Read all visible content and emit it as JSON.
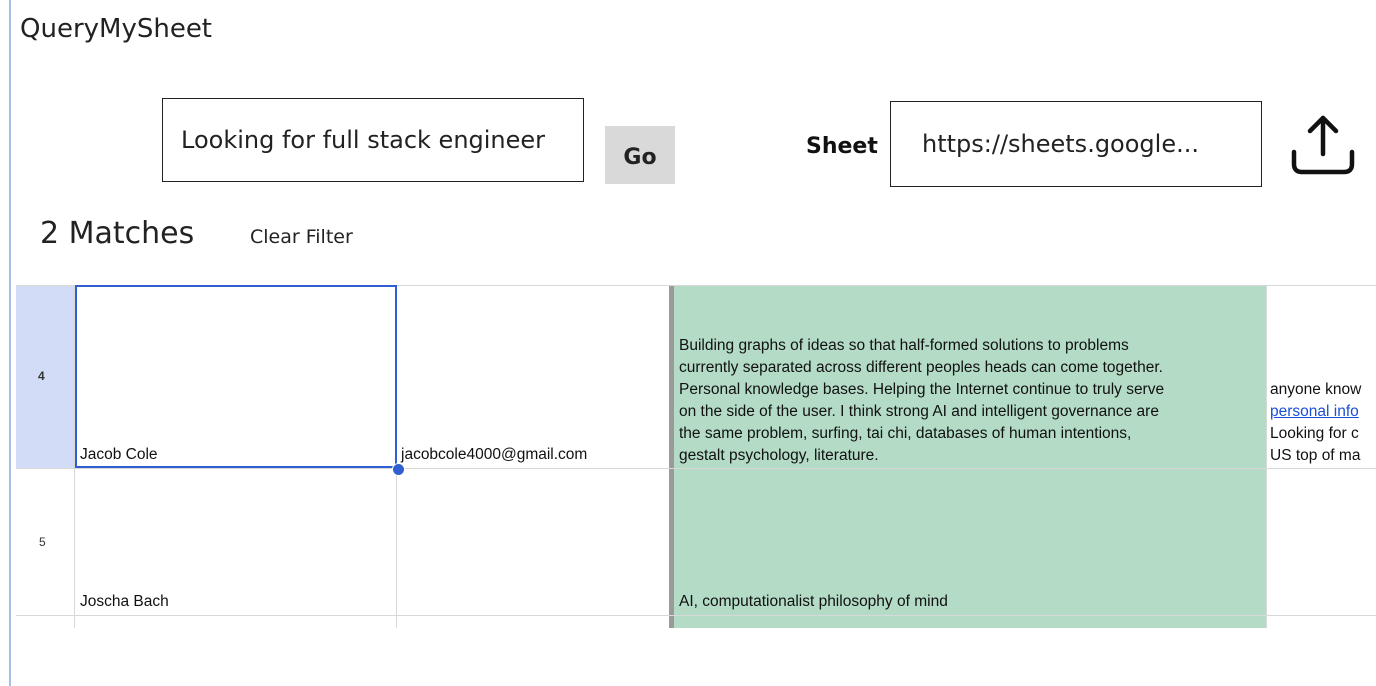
{
  "app": {
    "title": "QueryMySheet"
  },
  "search": {
    "value": "Looking for full stack engineer",
    "go_label": "Go"
  },
  "sheet": {
    "label": "Sheet",
    "url_value": "https://sheets.google...",
    "upload_icon": "upload-icon"
  },
  "results": {
    "count_label": "2 Matches",
    "clear_filter_label": "Clear Filter"
  },
  "table": {
    "rows": [
      {
        "row_number": "4",
        "name": "Jacob Cole",
        "email": "jacobcole4000@gmail.com",
        "interests_lines": [
          "Building graphs of ideas so that half-formed solutions to problems",
          "currently separated across different peoples heads can come together.",
          "Personal knowledge bases.  Helping the Internet continue to truly serve",
          "on the side of the user. I think strong AI and intelligent governance are",
          "the same problem, surfing, tai chi, databases of human intentions,",
          "gestalt psychology, literature."
        ],
        "next_col_lines": [
          "anyone know",
          "personal info",
          "Looking for c",
          "US top of ma"
        ]
      },
      {
        "row_number": "5",
        "name": "Joscha Bach",
        "email": "",
        "interests_lines": [
          "AI, computationalist philosophy of mind"
        ],
        "next_col_lines": []
      }
    ]
  },
  "colors": {
    "highlight_column": "#b3dbc6",
    "selected_row_header": "#d2dcf6",
    "selection_border": "#2f5fd0",
    "link": "#1a4fd6"
  }
}
